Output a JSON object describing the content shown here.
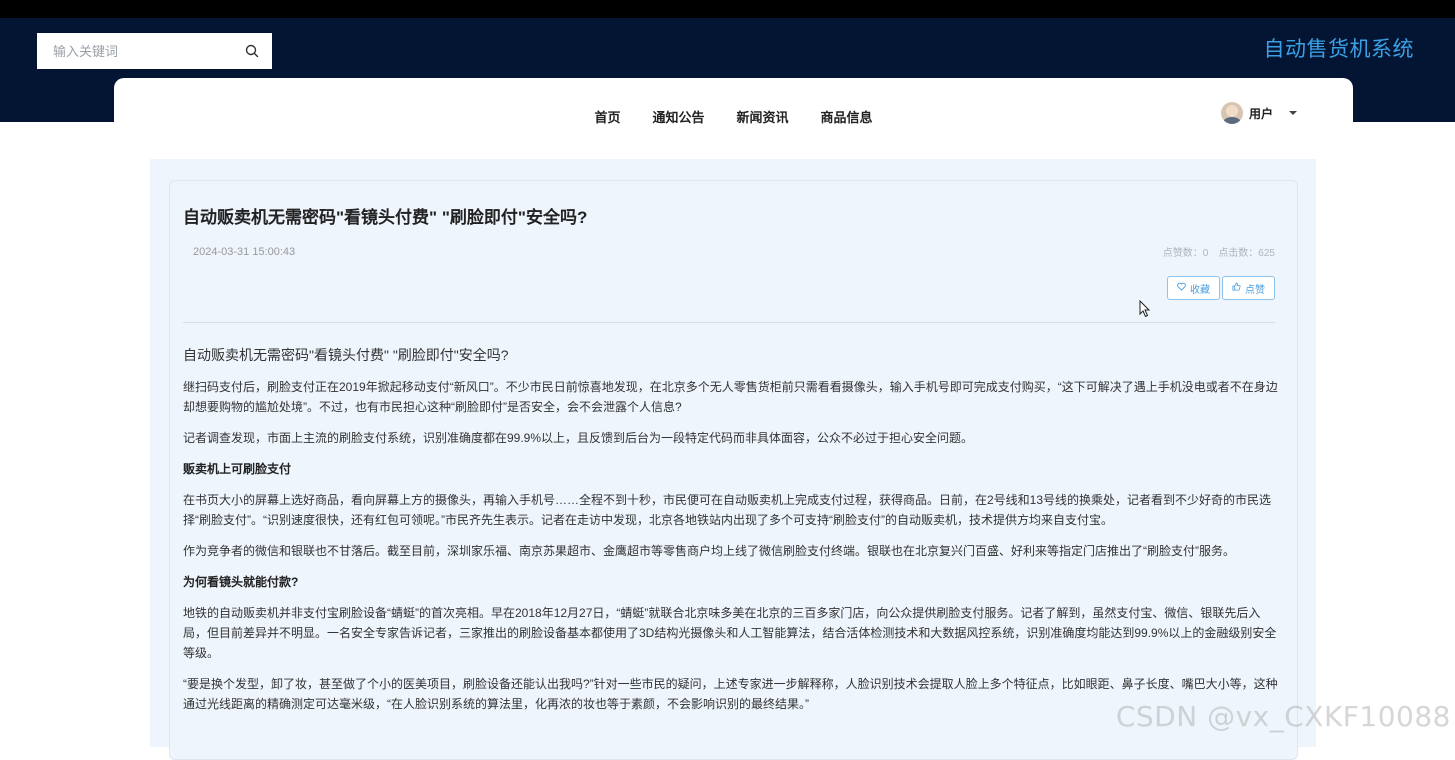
{
  "header": {
    "site_title": "自动售货机系统",
    "search": {
      "placeholder": "输入关键词",
      "value": ""
    }
  },
  "nav": {
    "items": [
      "首页",
      "通知公告",
      "新闻资讯",
      "商品信息"
    ],
    "user_label": "用户"
  },
  "article": {
    "title": "自动贩卖机无需密码\"看镜头付费\" \"刷脸即付\"安全吗?",
    "date": "2024-03-31 15:00:43",
    "likes_label": "点赞数：0",
    "clicks_label": "点击数：625",
    "favorite_label": "收藏",
    "like_label": "点赞",
    "lead": "自动贩卖机无需密码\"看镜头付费\" \"刷脸即付\"安全吗?",
    "paragraphs": [
      "继扫码支付后，刷脸支付正在2019年掀起移动支付“新风口”。不少市民日前惊喜地发现，在北京多个无人零售货柜前只需看看摄像头，输入手机号即可完成支付购买，“这下可解决了遇上手机没电或者不在身边却想要购物的尴尬处境”。不过，也有市民担心这种“刷脸即付”是否安全，会不会泄露个人信息?",
      "记者调查发现，市面上主流的刷脸支付系统，识别准确度都在99.9%以上，且反馈到后台为一段特定代码而非具体面容，公众不必过于担心安全问题。",
      "贩卖机上可刷脸支付",
      "在书页大小的屏幕上选好商品，看向屏幕上方的摄像头，再输入手机号……全程不到十秒，市民便可在自动贩卖机上完成支付过程，获得商品。日前，在2号线和13号线的换乘处，记者看到不少好奇的市民选择“刷脸支付”。“识别速度很快，还有红包可领呢。”市民齐先生表示。记者在走访中发现，北京各地铁站内出现了多个可支持“刷脸支付”的自动贩卖机，技术提供方均来自支付宝。",
      "作为竞争者的微信和银联也不甘落后。截至目前，深圳家乐福、南京苏果超市、金鹰超市等零售商户均上线了微信刷脸支付终端。银联也在北京复兴门百盛、好利来等指定门店推出了“刷脸支付”服务。",
      "为何看镜头就能付款?",
      "地铁的自动贩卖机并非支付宝刷脸设备“蜻蜓”的首次亮相。早在2018年12月27日，“蜻蜓”就联合北京味多美在北京的三百多家门店，向公众提供刷脸支付服务。记者了解到，虽然支付宝、微信、银联先后入局，但目前差异并不明显。一名安全专家告诉记者，三家推出的刷脸设备基本都使用了3D结构光摄像头和人工智能算法，结合活体检测技术和大数据风控系统，识别准确度均能达到99.9%以上的金融级别安全等级。",
      "“要是换个发型，卸了妆，甚至做了个小的医美项目，刷脸设备还能认出我吗?”针对一些市民的疑问，上述专家进一步解释称，人脸识别技术会提取人脸上多个特征点，比如眼距、鼻子长度、嘴巴大小等，这种通过光线距离的精确测定可达毫米级，“在人脸识别系统的算法里，化再浓的妆也等于素颜，不会影响识别的最终结果。”"
    ]
  },
  "watermark": "CSDN @vx_CXKF10088",
  "colors": {
    "header_bg": "#041533",
    "title_blue": "#3aa0e6",
    "content_bg": "#eef5fd",
    "button_border": "#8cc3ee"
  }
}
